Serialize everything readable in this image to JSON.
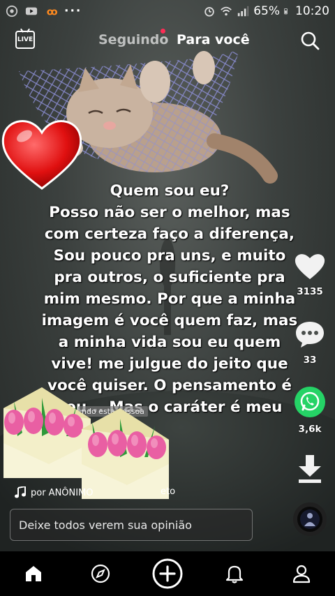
{
  "status_bar": {
    "battery": "65%",
    "time": "10:20",
    "dots": "···"
  },
  "top_nav": {
    "live_label": "LIVE",
    "tabs": [
      {
        "label": "Seguindo"
      },
      {
        "label": "Para você"
      }
    ]
  },
  "caption": {
    "lines": [
      "Quem sou eu?",
      "Posso não ser o melhor, mas",
      "com certeza faço a diferença,",
      "Sou pouco pra uns, e muito",
      "pra outros, o suficiente pra",
      "mim mesmo. Por que a minha",
      "imagem é você quem faz, mas",
      "a minha vida sou eu quem",
      "vive! me julgue do jeito que",
      "você quiser. O pensamento é",
      "seu... Mas o caráter é meu"
    ]
  },
  "overlay_label": "ndo esta pessoa",
  "actions": {
    "likes": "3135",
    "comments": "33",
    "shares": "3,6k"
  },
  "music": {
    "text": "por ANÔNIMO",
    "tail": "eto"
  },
  "comment_input": {
    "placeholder": "Deixe todos verem sua opinião"
  },
  "colors": {
    "accent_red": "#fe2c55",
    "whatsapp_green": "#25d366"
  }
}
